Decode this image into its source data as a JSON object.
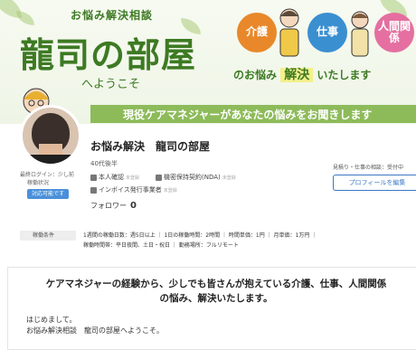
{
  "banner": {
    "subtitle": "お悩み解決相談",
    "title": "龍司の部屋",
    "welcome": "へようこそ",
    "circles": [
      "介護",
      "仕事",
      "人間関係"
    ],
    "circle_colors": [
      "#e8882a",
      "#3a8fd1",
      "#e56fa0"
    ],
    "worry_pre": "のお悩み",
    "worry_highlight": "解決",
    "worry_post": "いたします",
    "strip": "現役ケアマネジャーがあなたの悩みをお聞きします"
  },
  "profile": {
    "last_login": "最終ログイン：少し前",
    "status": "稼働状況",
    "available_badge": "対応可能です",
    "name": "お悩み解決　龍司の部屋",
    "age": "40代後半",
    "verify": [
      {
        "label": "本人確認",
        "tag": "未登録"
      },
      {
        "label": "機密保持契約(NDA)",
        "tag": "未登録"
      },
      {
        "label": "インボイス発行事業者",
        "tag": "未登録"
      }
    ],
    "follow_label": "フォロワー",
    "follow_count": "0",
    "estimate_note": "見積り・仕事の相談：受付中",
    "edit_button": "プロフィールを編集"
  },
  "conditions": {
    "label": "稼働条件",
    "lines": [
      "1週間の稼働日数：週5日以上 ｜ 1日の稼働時間：2時間 ｜ 時間単価：1円 ｜ 月単価：1万円 ｜",
      "稼働時間帯：平日夜間、土日・祝日 ｜ 勤務場所：フルリモート"
    ]
  },
  "message": {
    "title_line1": "ケアマネジャーの経験から、少しでも皆さんが抱えている介護、仕事、人間関係",
    "title_line2": "の悩み、解決いたします。",
    "greeting": "はじめまして。",
    "intro": "お悩み解決相談　龍司の部屋へようこそ。"
  }
}
